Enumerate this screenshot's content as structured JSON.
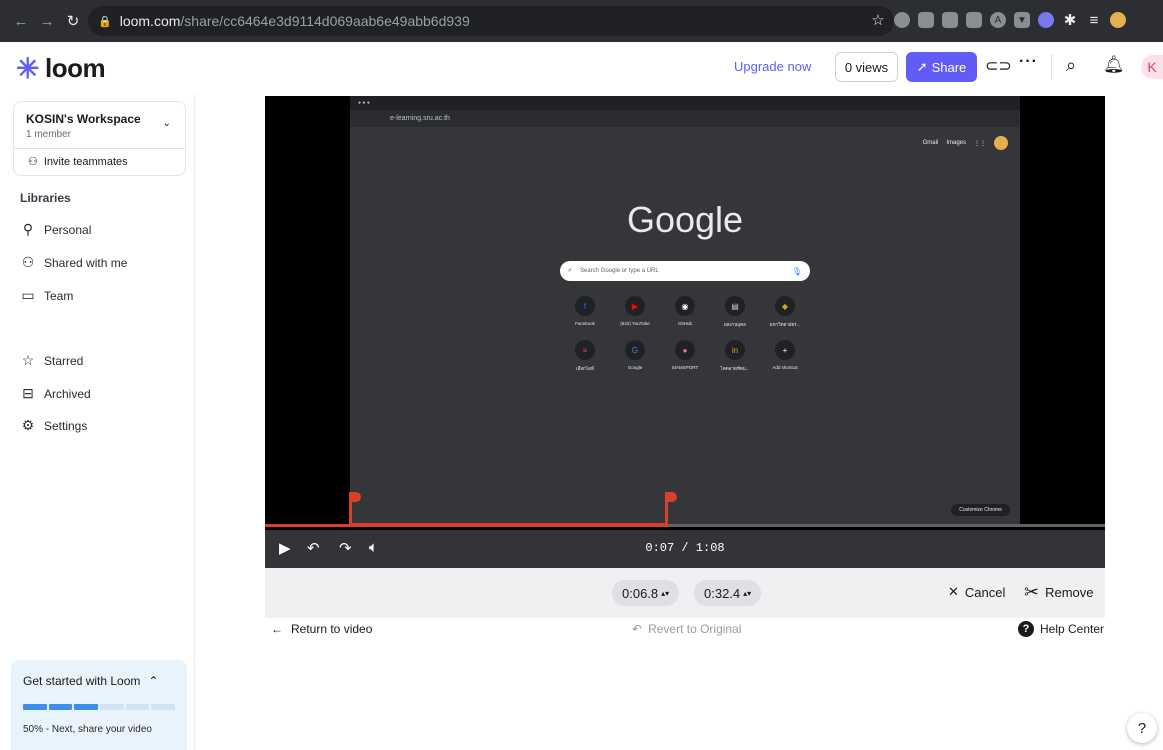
{
  "browser": {
    "url_host": "loom.com",
    "url_path": "/share/cc6464e3d9114d069aab6e49abb6d939"
  },
  "header": {
    "logo_text": "loom",
    "upgrade": "Upgrade now",
    "views": "0 views",
    "share": "Share",
    "avatar_letter": "K"
  },
  "sidebar": {
    "workspace_name": "KOSIN's Workspace",
    "workspace_members": "1 member",
    "invite": "Invite teammates",
    "libraries_title": "Libraries",
    "items": [
      {
        "label": "Personal",
        "icon": "person-icon"
      },
      {
        "label": "Shared with me",
        "icon": "people-icon"
      },
      {
        "label": "Team",
        "icon": "team-icon"
      },
      {
        "label": "Starred",
        "icon": "star-icon"
      },
      {
        "label": "Archived",
        "icon": "archive-icon"
      },
      {
        "label": "Settings",
        "icon": "gear-icon"
      }
    ],
    "get_started": {
      "title": "Get started with Loom",
      "progress_fraction": 0.5,
      "text": "50% - Next, share your video"
    }
  },
  "video": {
    "inner_url": "e-learning.sru.ac.th",
    "inner_links": [
      "Gmail",
      "Images"
    ],
    "google_logo": "Google",
    "search_placeholder": "Search Google or type a URL",
    "shortcuts": [
      {
        "label": "Facebook",
        "glyph": "f",
        "color": "#1877f2"
      },
      {
        "label": "(642) YouTube",
        "glyph": "▶",
        "color": "#ff0000"
      },
      {
        "label": "GitHub",
        "glyph": "◉",
        "color": "#ffffff"
      },
      {
        "label": "ผลงานบุคล",
        "glyph": "▤",
        "color": "#cccccc"
      },
      {
        "label": "มหาวิทยาลัยร...",
        "glyph": "◆",
        "color": "#c8a82a"
      },
      {
        "label": "เลือกไลฟ์",
        "glyph": "≡",
        "color": "#e04444"
      },
      {
        "label": "Google",
        "glyph": "G",
        "color": "#4285f4"
      },
      {
        "label": "SIAMSPORT",
        "glyph": "●",
        "color": "#ff6b81"
      },
      {
        "label": "ไคตลาดทีคม...",
        "glyph": "in",
        "color": "#f0a020"
      },
      {
        "label": "Add shortcut",
        "glyph": "+",
        "color": "#ffffff"
      }
    ],
    "customize": "Customize Chrome",
    "time": "0:07 / 1:08",
    "progress_fraction": 0.48,
    "trim_start_fraction": 0.1,
    "trim_end_fraction": 0.48
  },
  "trim": {
    "start": "0:06.8",
    "end": "0:32.4",
    "cancel": "Cancel",
    "remove": "Remove"
  },
  "footer": {
    "return": "Return to video",
    "revert": "Revert to Original",
    "help": "Help Center",
    "help_fab": "?"
  }
}
